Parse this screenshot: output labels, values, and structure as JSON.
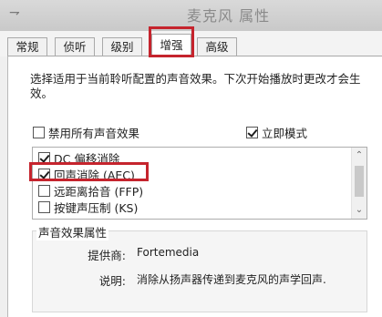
{
  "window": {
    "title": "麦克风 属性"
  },
  "tabs": [
    {
      "label": "常规"
    },
    {
      "label": "侦听"
    },
    {
      "label": "级别"
    },
    {
      "label": "增强"
    },
    {
      "label": "高级"
    }
  ],
  "active_tab": "增强",
  "description": "选择适用于当前聆听配置的声音效果。下次开始播放时更改才会生效。",
  "disable_all": {
    "label": "禁用所有声音效果",
    "checked": false
  },
  "immediate_mode": {
    "label": "立即模式",
    "checked": true
  },
  "effects": [
    {
      "label": "DC 偏移消除",
      "checked": true
    },
    {
      "label": "回声消除 (AEC)",
      "checked": true
    },
    {
      "label": "远距离拾音 (FFP)",
      "checked": false
    },
    {
      "label": "按键声压制 (KS)",
      "checked": false
    }
  ],
  "properties": {
    "group_title": "声音效果属性",
    "provider_label": "提供商:",
    "provider_value": "Fortemedia",
    "description_label": "说明:",
    "description_value": "消除从扬声器传递到麦克风的声学回声."
  },
  "colors": {
    "highlight": "#c5242d",
    "window_bg": "#efefef"
  }
}
